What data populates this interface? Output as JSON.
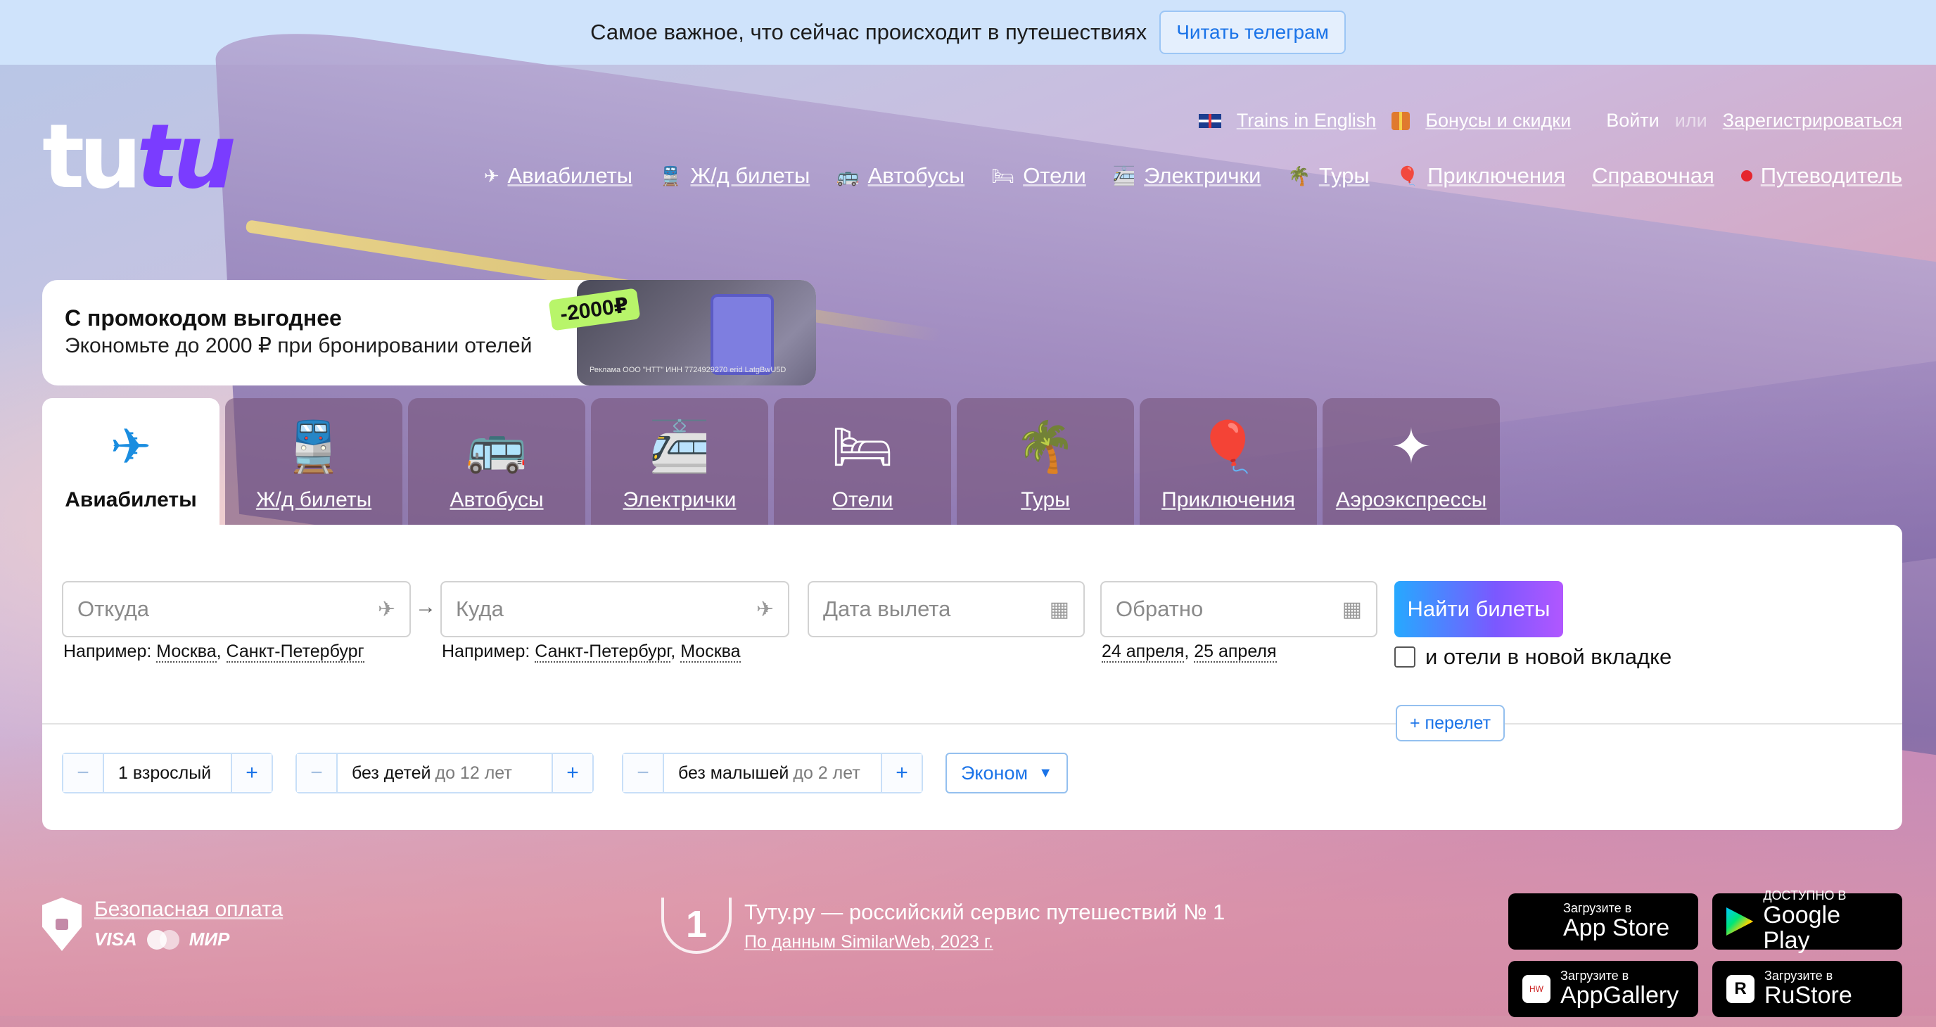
{
  "top_banner": {
    "text": "Самое важное, что сейчас происходит в путешествиях",
    "button": "Читать телеграм"
  },
  "logo": {
    "part1": "tu",
    "part2": "tu"
  },
  "header": {
    "top_links": {
      "trains_english": "Trains in English",
      "bonuses": "Бонусы и скидки",
      "login": "Войти",
      "or": "или",
      "register": "Зарегистрироваться"
    },
    "nav": [
      {
        "icon": "plane-icon",
        "label": "Авиабилеты"
      },
      {
        "icon": "train-icon",
        "label": "Ж/д билеты"
      },
      {
        "icon": "bus-icon",
        "label": "Автобусы"
      },
      {
        "icon": "bed-icon",
        "label": "Отели"
      },
      {
        "icon": "commuter-train-icon",
        "label": "Электрички"
      },
      {
        "icon": "palm-icon",
        "label": "Туры"
      },
      {
        "icon": "balloon-icon",
        "label": "Приключения"
      },
      {
        "icon": "",
        "label": "Справочная"
      },
      {
        "icon": "red-dot-icon",
        "label": "Путеводитель"
      }
    ]
  },
  "promo": {
    "title": "С промокодом выгоднее",
    "subtitle": "Экономьте до 2000 ₽ при бронировании отелей",
    "badge": "-2000₽",
    "ad_text": "Реклама ООО \"НТТ\" ИНН 7724929270 erid LatgBwU5D",
    "close": "✕"
  },
  "tabs": [
    {
      "icon": "plane-icon",
      "label": "Авиабилеты",
      "active": true
    },
    {
      "icon": "train-icon",
      "label": "Ж/д билеты"
    },
    {
      "icon": "bus-icon",
      "label": "Автобусы"
    },
    {
      "icon": "commuter-train-icon",
      "label": "Электрички"
    },
    {
      "icon": "bed-icon",
      "label": "Отели"
    },
    {
      "icon": "palm-icon",
      "label": "Туры"
    },
    {
      "icon": "balloon-icon",
      "label": "Приключения"
    },
    {
      "icon": "star-icon",
      "label": "Аэроэкспрессы"
    }
  ],
  "search": {
    "from_placeholder": "Откуда",
    "to_placeholder": "Куда",
    "date_placeholder": "Дата вылета",
    "return_placeholder": "Обратно",
    "from_hint_prefix": "Например:",
    "from_hint_1": "Москва",
    "from_hint_2": "Санкт-Петербург",
    "to_hint_prefix": "Например:",
    "to_hint_1": "Санкт-Петербург",
    "to_hint_2": "Москва",
    "date_hint_1": "24 апреля",
    "date_hint_2": "25 апреля",
    "find_button": "Найти билеты",
    "hotels_checkbox": "и отели в новой вкладке",
    "add_flight": "+ перелет",
    "adults": "1 взрослый",
    "children": "без детей",
    "children_note": "до 12 лет",
    "infants": "без малышей",
    "infants_note": "до 2 лет",
    "cabin_class": "Эконом",
    "minus": "−",
    "plus": "+"
  },
  "footer": {
    "secure_payment": "Безопасная оплата",
    "visa": "VISA",
    "mir": "МИР",
    "rank_number": "1",
    "rank_text": "Туту.ру — российский сервис путешествий № 1",
    "rank_source": "По данным SimilarWeb, 2023 г.",
    "stores": [
      {
        "small": "Загрузите в",
        "big": "App Store"
      },
      {
        "small": "ДОСТУПНО В",
        "big": "Google Play"
      },
      {
        "small": "Загрузите в",
        "big": "AppGallery"
      },
      {
        "small": "Загрузите в",
        "big": "RuStore"
      }
    ]
  }
}
